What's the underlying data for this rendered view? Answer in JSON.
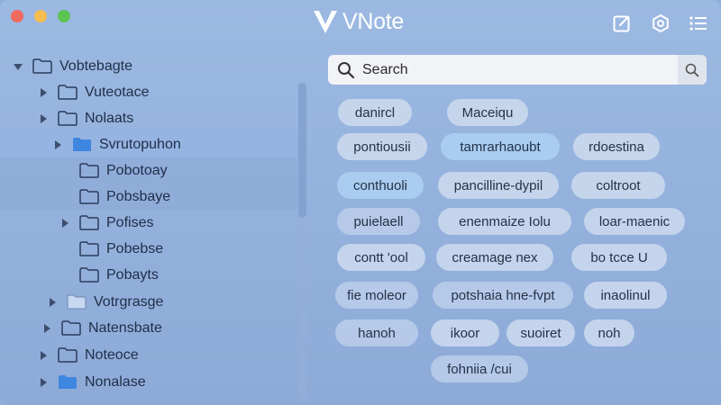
{
  "window": {
    "title": "VNote"
  },
  "toolbar": {
    "icons": [
      "edit-icon",
      "settings-icon",
      "menu-icon"
    ]
  },
  "sidebar": {
    "items": [
      {
        "label": "Vobtebagte",
        "expanded": true
      },
      {
        "label": "Vuteotace",
        "expanded": false
      },
      {
        "label": "Nolaats",
        "expanded": false
      },
      {
        "label": "Svrutopuhon",
        "expanded": false,
        "selected": true
      },
      {
        "label": "Pobotoay"
      },
      {
        "label": "Pobsbaye"
      },
      {
        "label": "Pofises",
        "expanded": false
      },
      {
        "label": "Pobebse"
      },
      {
        "label": "Pobayts"
      },
      {
        "label": "Votrgrasge",
        "expanded": false
      },
      {
        "label": "Natensbate",
        "expanded": false
      },
      {
        "label": "Noteoce",
        "expanded": false
      },
      {
        "label": "Nonalase",
        "expanded": false
      }
    ]
  },
  "search": {
    "placeholder": "Search",
    "value": ""
  },
  "tags": [
    "danircl",
    "Maceiqu",
    "pontiousii",
    "tamrarhaoubt",
    "rdoestina",
    "conthuoli",
    "pancilline-dypil",
    "coltroot",
    "puielaell",
    "enenmaize Iolu",
    "loar-maenic",
    "contt 'ool",
    "creamage nex",
    "bo tcce U",
    "fie moleor",
    "potshaia hne-fvpt",
    "inaolinul",
    "hanoh",
    "ikoor",
    "suoiret",
    "noh",
    "fohniia /cui"
  ],
  "colors": {
    "window_bg": "#9cb9e2",
    "selected_row": "#96b4e1",
    "folder_blue": "#3f86e0",
    "tag_bg": "#cddaee",
    "tag_blue": "#aacdf0"
  }
}
